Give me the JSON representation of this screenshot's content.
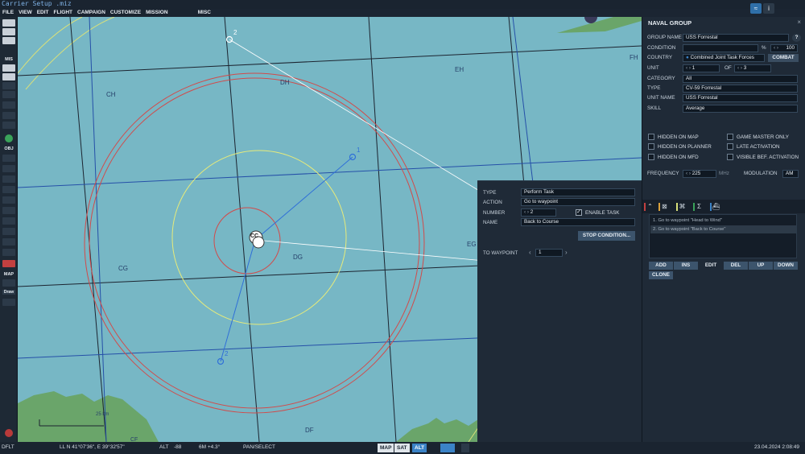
{
  "window": {
    "title": "Carrier Setup .miz"
  },
  "menu": [
    "FILE",
    "VIEW",
    "EDIT",
    "FLIGHT",
    "CAMPAIGN",
    "CUSTOMIZE",
    "MISSION GENERATOR",
    "MISC"
  ],
  "left_toolbar": {
    "sections": [
      "MIS",
      "OBJ",
      "MAP"
    ],
    "draw_label": "Draw"
  },
  "map": {
    "grid_labels": [
      "CH",
      "DH",
      "EH",
      "FH",
      "CG",
      "DG",
      "EG",
      "DF",
      "CF"
    ],
    "waypoints": [
      "1",
      "2",
      "2"
    ],
    "unit_marker": "CC",
    "scale_label": "25 km"
  },
  "panel": {
    "title": "NAVAL GROUP",
    "close": "×",
    "help": "?",
    "group_name_label": "GROUP NAME",
    "group_name_value": "USS Forrestal",
    "condition_label": "CONDITION",
    "condition_unit": "%",
    "condition_value": "100",
    "country_label": "COUNTRY",
    "country_value": "Combined Joint Task Forces",
    "combat_button": "COMBAT",
    "unit_label": "UNIT",
    "unit_value": "1",
    "of_label": "OF",
    "of_value": "3",
    "category_label": "CATEGORY",
    "category_value": "All",
    "type_label": "TYPE",
    "type_value": "CV-59 Forrestal",
    "unit_name_label": "UNIT NAME",
    "unit_name_value": "USS Forrestal",
    "skill_label": "SKILL",
    "skill_value": "Average",
    "checkboxes": [
      {
        "label": "HIDDEN ON MAP"
      },
      {
        "label": "GAME MASTER ONLY"
      },
      {
        "label": "HIDDEN ON PLANNER"
      },
      {
        "label": "LATE ACTIVATION"
      },
      {
        "label": "HIDDEN ON MFD"
      },
      {
        "label": "VISIBLE BEF. ACTIVATION"
      }
    ],
    "frequency_label": "FREQUENCY",
    "frequency_value": "225",
    "frequency_unit": "MHz",
    "modulation_label": "MODULATION",
    "modulation_value": "AM",
    "tasks": [
      "1. Go to waypoint \"Head to Wind\"",
      "2. Go to waypoint \"Back to Course\""
    ],
    "task_buttons": [
      "ADD",
      "INS",
      "EDIT",
      "DEL",
      "UP",
      "DOWN"
    ],
    "clone_button": "CLONE"
  },
  "task": {
    "type_label": "TYPE",
    "type_value": "Perform Task",
    "action_label": "ACTION",
    "action_value": "Go to waypoint",
    "number_label": "NUMBER",
    "number_value": "2",
    "enable_label": "ENABLE TASK",
    "name_label": "NAME",
    "name_value": "Back to Course",
    "stop_button": "STOP CONDITION...",
    "to_waypoint_label": "TO WAYPOINT",
    "to_waypoint_value": "1"
  },
  "status": {
    "profile": "DFLT",
    "coords": "LL  N 41°07'36\", E 39°32'57\"",
    "alt_label": "ALT",
    "alt_value": "-88",
    "mag": "6M  +4.3°",
    "mode": "PAN/SELECT",
    "buttons": [
      "MAP",
      "SAT",
      "ALT"
    ],
    "datetime": "23.04.2024 2:08:49"
  },
  "colors": {
    "sea": "#77b7c5",
    "land": "#6aa56a",
    "panel": "#1f2a37",
    "accent": "#3b83c7"
  }
}
